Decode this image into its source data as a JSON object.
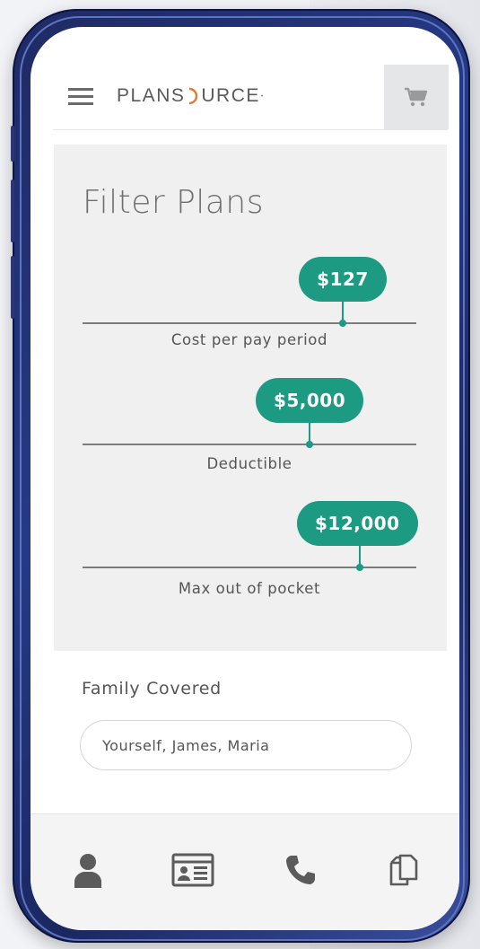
{
  "header": {
    "logo_text_left": "PLANS",
    "logo_text_right": "URCE",
    "logo_accent_color": "#e07a2e",
    "menu_icon": "hamburger-icon",
    "cart_icon": "cart-icon"
  },
  "filter": {
    "title": "Filter Plans",
    "accent_color": "#1c9a82",
    "sliders": [
      {
        "value_label": "$127",
        "caption": "Cost per pay period",
        "fraction": 0.78
      },
      {
        "value_label": "$5,000",
        "caption": "Deductible",
        "fraction": 0.68
      },
      {
        "value_label": "$12,000",
        "caption": "Max out of pocket",
        "fraction": 0.83
      }
    ]
  },
  "family": {
    "label": "Family Covered",
    "value": "Yourself, James, Maria"
  },
  "bottom_nav": {
    "icons": [
      "person-icon",
      "id-card-icon",
      "phone-icon",
      "documents-icon"
    ]
  }
}
